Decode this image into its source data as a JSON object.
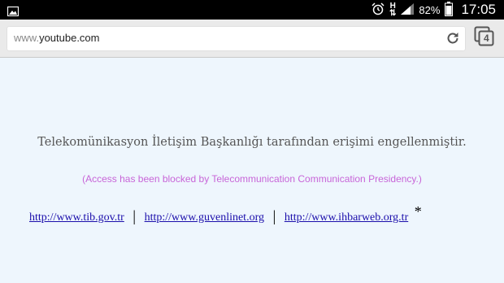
{
  "status_bar": {
    "battery": "82%",
    "time": "17:05",
    "network": "H"
  },
  "browser": {
    "url_prefix": "www.",
    "url_domain": "youtube.com",
    "tab_count": "4"
  },
  "page": {
    "message_tr": "Telekomünikasyon İletişim Başkanlığı tarafından erişimi engellenmiştir.",
    "message_en": "(Access has been blocked by Telecommunication Communication Presidency.)",
    "links": [
      "http://www.tib.gov.tr",
      "http://www.guvenlinet.org",
      "http://www.ihbarweb.org.tr"
    ],
    "separator": "|",
    "asterisk": "*"
  },
  "colors": {
    "background": "#eef6fd",
    "english_message": "#c865d8",
    "link": "#1a0dab"
  }
}
